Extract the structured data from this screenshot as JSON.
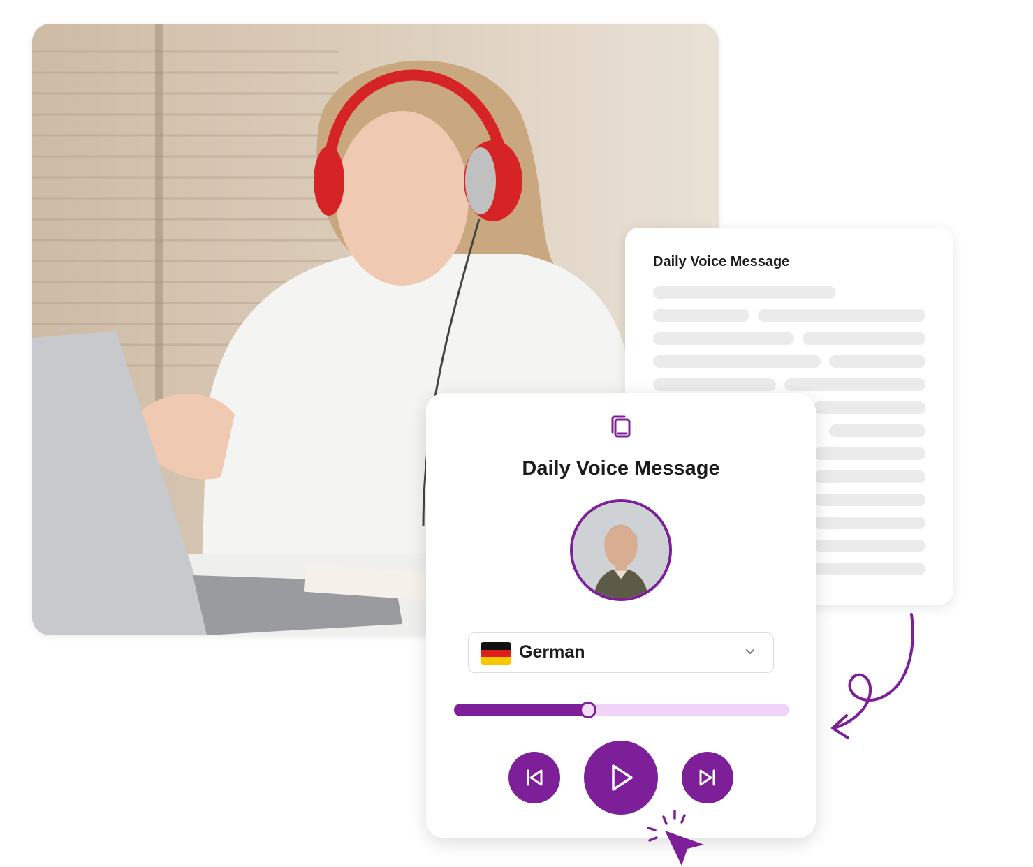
{
  "transcript_card": {
    "title": "Daily Voice Message"
  },
  "player_card": {
    "title": "Daily Voice Message",
    "language_select": {
      "selected": "German"
    },
    "progress": 0.4
  },
  "colors": {
    "accent": "#7d1f98",
    "track": "#efd4f8",
    "skeleton": "#ebebeb"
  },
  "icons": {
    "header": "copy-icon",
    "previous": "skip-previous-icon",
    "play": "play-icon",
    "next": "skip-next-icon",
    "pointer": "cursor-click-icon",
    "dropdown": "chevron-down-icon",
    "flag": "german-flag-icon"
  }
}
